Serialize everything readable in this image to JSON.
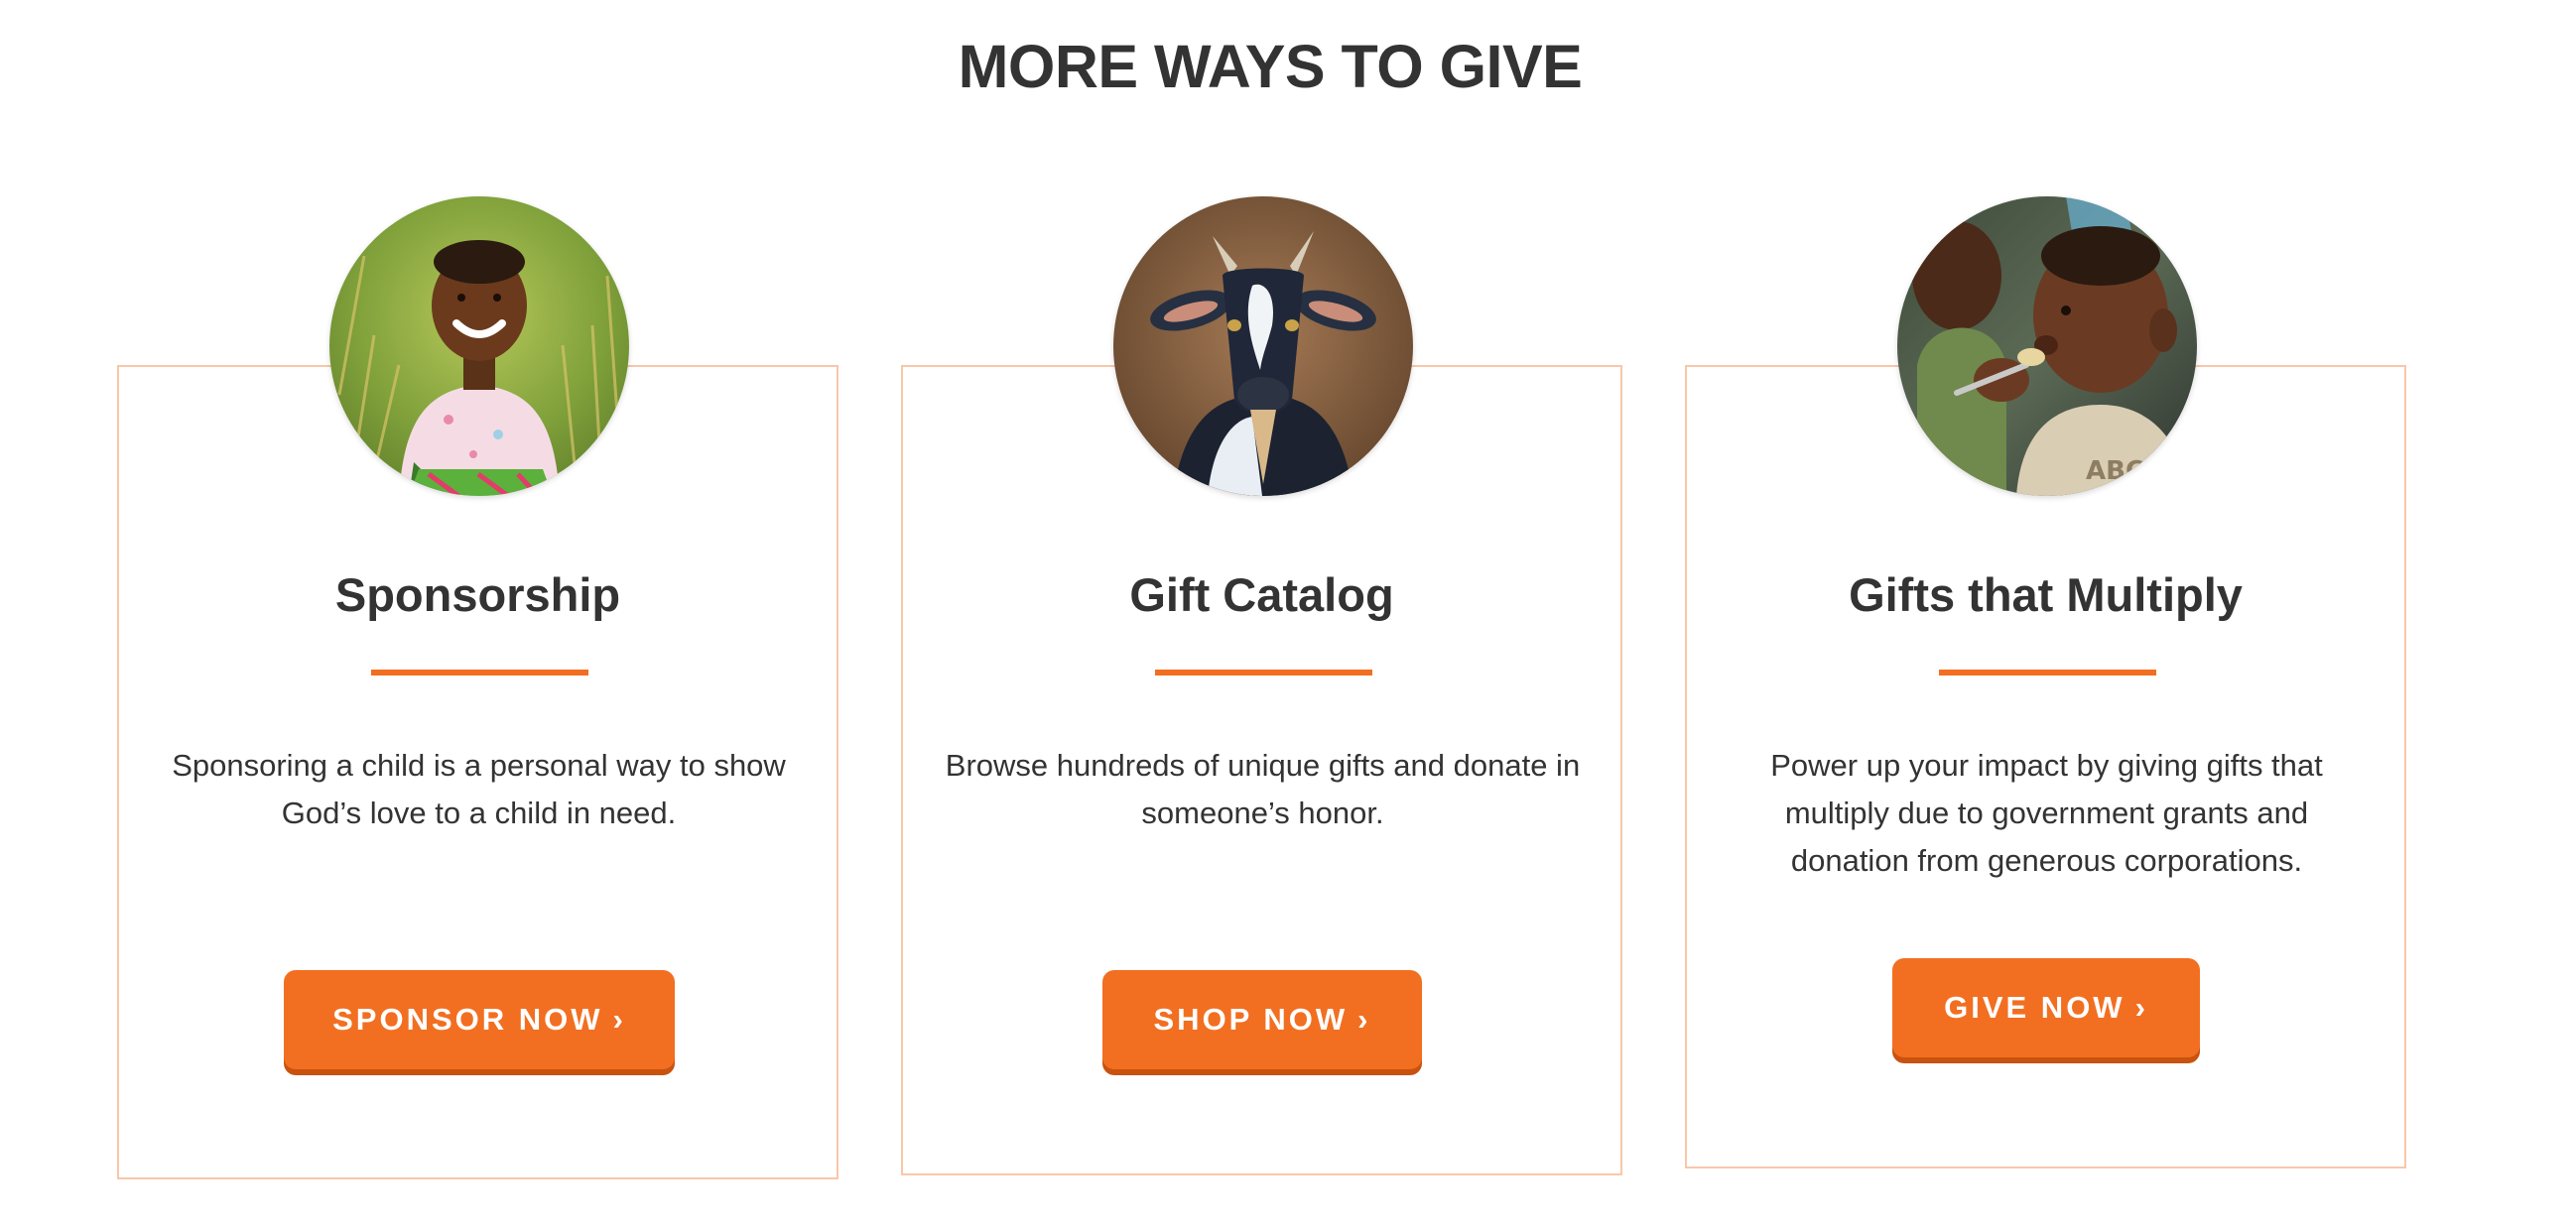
{
  "section": {
    "title": "MORE WAYS TO GIVE"
  },
  "cards": [
    {
      "title": "Sponsorship",
      "description": "Sponsoring a child is a personal way to show God’s love to a child in need.",
      "button_label": "SPONSOR NOW",
      "image": "child-portrait"
    },
    {
      "title": "Gift Catalog",
      "description": "Browse hundreds of unique gifts and donate in someone’s honor.",
      "button_label": "SHOP NOW",
      "image": "goat-portrait"
    },
    {
      "title": "Gifts that Multiply",
      "description": "Power up your impact by giving gifts that multiply due to  government grants and donation from generous corporations.",
      "button_label": "GIVE NOW",
      "image": "child-eating-portrait"
    }
  ],
  "icons": {
    "button_chevron": "chevron-right-icon"
  },
  "colors": {
    "accent": "#f26f21",
    "accent_shadow": "#c9520f",
    "card_border": "#f9c7a9",
    "text": "#333333",
    "background": "#ffffff"
  }
}
